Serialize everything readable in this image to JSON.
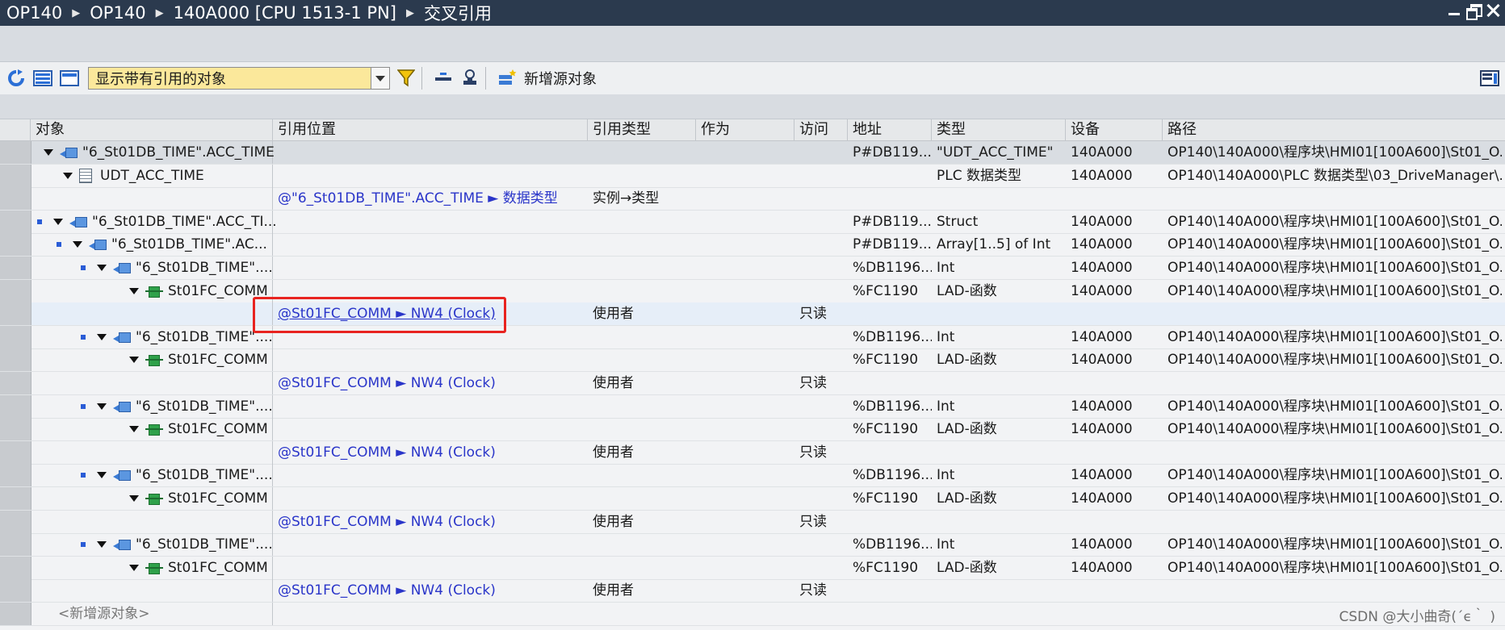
{
  "titlebar": {
    "crumbs": [
      "OP140",
      "OP140",
      "140A000 [CPU 1513-1 PN]",
      "交叉引用"
    ]
  },
  "toolbar": {
    "filter_value": "显示带有引用的对象",
    "new_source_label": "新增源对象"
  },
  "table": {
    "columns": [
      "对象",
      "引用位置",
      "引用类型",
      "作为",
      "访问",
      "地址",
      "类型",
      "设备",
      "路径"
    ],
    "rows": [
      {
        "obj": "\"6_St01DB_TIME\".ACC_TIME",
        "loc": "",
        "reftype": "",
        "as": "",
        "access": "",
        "addr": "P#DB119...",
        "type": "\"UDT_ACC_TIME\"",
        "device": "140A000",
        "path": "OP140\\140A000\\程序块\\HMI01[100A600]\\St01_O..."
      },
      {
        "obj": "UDT_ACC_TIME",
        "loc": "",
        "reftype": "",
        "as": "",
        "access": "",
        "addr": "",
        "type": "PLC 数据类型",
        "device": "140A000",
        "path": "OP140\\140A000\\PLC 数据类型\\03_DriveManager\\..."
      },
      {
        "obj": "",
        "loc": "@\"6_St01DB_TIME\".ACC_TIME ► 数据类型",
        "reftype": "实例→类型",
        "as": "",
        "access": "",
        "addr": "",
        "type": "",
        "device": "",
        "path": ""
      },
      {
        "obj": "\"6_St01DB_TIME\".ACC_TI...",
        "loc": "",
        "reftype": "",
        "as": "",
        "access": "",
        "addr": "P#DB119...",
        "type": "Struct",
        "device": "140A000",
        "path": "OP140\\140A000\\程序块\\HMI01[100A600]\\St01_O..."
      },
      {
        "obj": "\"6_St01DB_TIME\".AC...",
        "loc": "",
        "reftype": "",
        "as": "",
        "access": "",
        "addr": "P#DB119...",
        "type": "Array[1..5] of Int",
        "device": "140A000",
        "path": "OP140\\140A000\\程序块\\HMI01[100A600]\\St01_O..."
      },
      {
        "obj": "\"6_St01DB_TIME\"....",
        "loc": "",
        "reftype": "",
        "as": "",
        "access": "",
        "addr": "%DB1196...",
        "type": "Int",
        "device": "140A000",
        "path": "OP140\\140A000\\程序块\\HMI01[100A600]\\St01_O..."
      },
      {
        "obj": "St01FC_COMM",
        "loc": "",
        "reftype": "",
        "as": "",
        "access": "",
        "addr": "%FC1190",
        "type": "LAD-函数",
        "device": "140A000",
        "path": "OP140\\140A000\\程序块\\HMI01[100A600]\\St01_O..."
      },
      {
        "obj": "",
        "loc": "@St01FC_COMM ► NW4 (Clock)",
        "reftype": "使用者",
        "as": "",
        "access": "只读",
        "addr": "",
        "type": "",
        "device": "",
        "path": ""
      },
      {
        "obj": "\"6_St01DB_TIME\"....",
        "loc": "",
        "reftype": "",
        "as": "",
        "access": "",
        "addr": "%DB1196...",
        "type": "Int",
        "device": "140A000",
        "path": "OP140\\140A000\\程序块\\HMI01[100A600]\\St01_O..."
      },
      {
        "obj": "St01FC_COMM",
        "loc": "",
        "reftype": "",
        "as": "",
        "access": "",
        "addr": "%FC1190",
        "type": "LAD-函数",
        "device": "140A000",
        "path": "OP140\\140A000\\程序块\\HMI01[100A600]\\St01_O..."
      },
      {
        "obj": "",
        "loc": "@St01FC_COMM ► NW4 (Clock)",
        "reftype": "使用者",
        "as": "",
        "access": "只读",
        "addr": "",
        "type": "",
        "device": "",
        "path": ""
      },
      {
        "obj": "\"6_St01DB_TIME\"....",
        "loc": "",
        "reftype": "",
        "as": "",
        "access": "",
        "addr": "%DB1196...",
        "type": "Int",
        "device": "140A000",
        "path": "OP140\\140A000\\程序块\\HMI01[100A600]\\St01_O..."
      },
      {
        "obj": "St01FC_COMM",
        "loc": "",
        "reftype": "",
        "as": "",
        "access": "",
        "addr": "%FC1190",
        "type": "LAD-函数",
        "device": "140A000",
        "path": "OP140\\140A000\\程序块\\HMI01[100A600]\\St01_O..."
      },
      {
        "obj": "",
        "loc": "@St01FC_COMM ► NW4 (Clock)",
        "reftype": "使用者",
        "as": "",
        "access": "只读",
        "addr": "",
        "type": "",
        "device": "",
        "path": ""
      },
      {
        "obj": "\"6_St01DB_TIME\"....",
        "loc": "",
        "reftype": "",
        "as": "",
        "access": "",
        "addr": "%DB1196...",
        "type": "Int",
        "device": "140A000",
        "path": "OP140\\140A000\\程序块\\HMI01[100A600]\\St01_O..."
      },
      {
        "obj": "St01FC_COMM",
        "loc": "",
        "reftype": "",
        "as": "",
        "access": "",
        "addr": "%FC1190",
        "type": "LAD-函数",
        "device": "140A000",
        "path": "OP140\\140A000\\程序块\\HMI01[100A600]\\St01_O..."
      },
      {
        "obj": "",
        "loc": "@St01FC_COMM ► NW4 (Clock)",
        "reftype": "使用者",
        "as": "",
        "access": "只读",
        "addr": "",
        "type": "",
        "device": "",
        "path": ""
      },
      {
        "obj": "\"6_St01DB_TIME\"....",
        "loc": "",
        "reftype": "",
        "as": "",
        "access": "",
        "addr": "%DB1196...",
        "type": "Int",
        "device": "140A000",
        "path": "OP140\\140A000\\程序块\\HMI01[100A600]\\St01_O..."
      },
      {
        "obj": "St01FC_COMM",
        "loc": "",
        "reftype": "",
        "as": "",
        "access": "",
        "addr": "%FC1190",
        "type": "LAD-函数",
        "device": "140A000",
        "path": "OP140\\140A000\\程序块\\HMI01[100A600]\\St01_O..."
      },
      {
        "obj": "",
        "loc": "@St01FC_COMM ► NW4 (Clock)",
        "reftype": "使用者",
        "as": "",
        "access": "只读",
        "addr": "",
        "type": "",
        "device": "",
        "path": ""
      }
    ],
    "new_source_row": "<新增源对象>"
  },
  "watermark": "CSDN @大小曲奇(´ϵ｀ )"
}
